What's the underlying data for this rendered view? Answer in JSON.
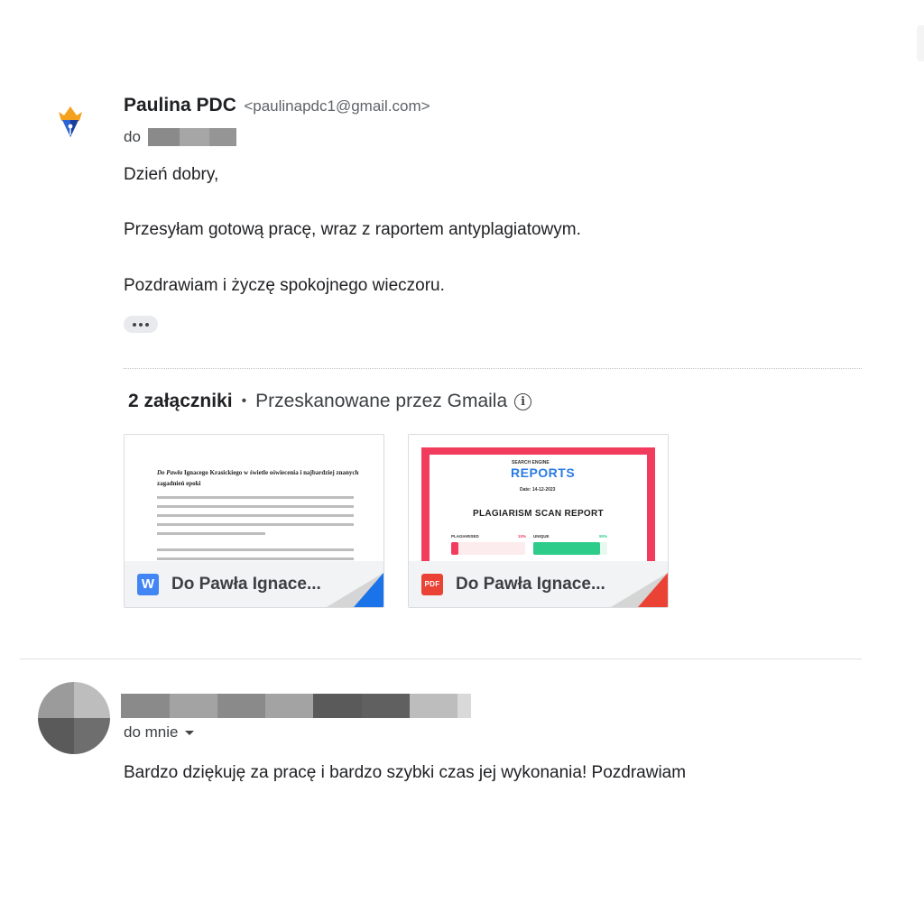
{
  "message1": {
    "sender_name": "Paulina PDC",
    "sender_email": "<paulinapdc1@gmail.com>",
    "to_label": "do",
    "body_greeting": "Dzień dobry,",
    "body_main": "Przesyłam gotową pracę, wraz z raportem antyplagiatowym.",
    "body_closing": "Pozdrawiam i życzę spokojnego wieczoru.",
    "attachments_count": "2 załączniki",
    "attachments_separator": "•",
    "scanned_label": "Przeskanowane przez Gmaila",
    "attachments": [
      {
        "name": "Do Pawła Ignace...",
        "icon_label": "W",
        "icon": "word-doc-icon",
        "type_color": "#4285f4",
        "preview": {
          "title_italic": "Do Pawła",
          "title_rest": " Ignacego Krasickiego w świetle oświecenia i najbardziej znanych zagadnień epoki"
        }
      },
      {
        "name": "Do Pawła Ignace...",
        "icon_label": "PDF",
        "icon": "pdf-icon",
        "type_color": "#ea4335",
        "preview": {
          "logo_top": "SEARCH ENGINE",
          "logo_main": "REPORTS",
          "date": "Date: 14-12-2023",
          "title": "PLAGIARISM SCAN REPORT",
          "plagiarised_label": "PLAGIARISED",
          "plagiarised_pct": "10%",
          "plagiarised_value": 10,
          "unique_label": "UNIQUE",
          "unique_pct": "90%",
          "unique_value": 90
        }
      }
    ]
  },
  "message2": {
    "to_label": "do mnie",
    "body": "Bardzo dziękuję za pracę i bardzo szybki czas jej wykonania! Pozdrawiam"
  },
  "colors": {
    "pdf_frame": "#f13c5d",
    "plagiarised": "#f13c5d",
    "unique": "#2ecc8a"
  }
}
